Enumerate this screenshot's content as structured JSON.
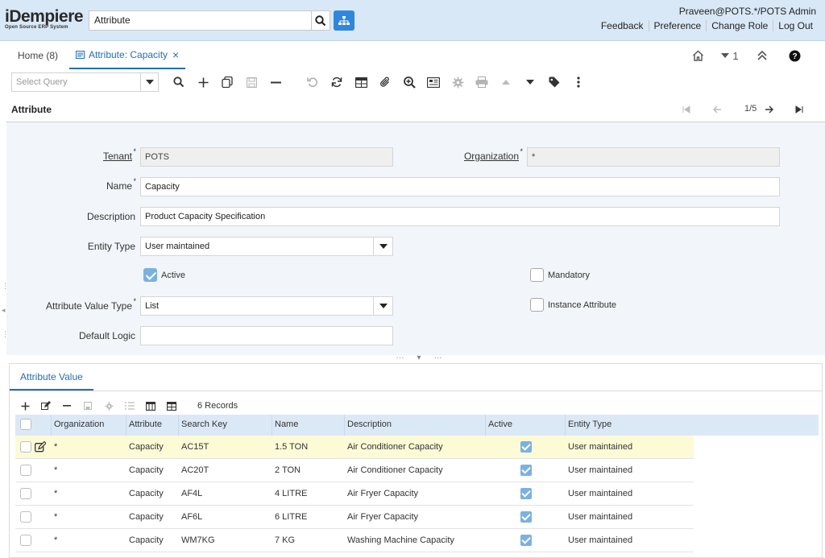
{
  "header": {
    "logo_text": "iDempiere",
    "logo_subtext": "Open Source ERP System",
    "search_value": "Attribute",
    "user": "Praveen@POTS.*/POTS Admin",
    "links": [
      "Feedback",
      "Preference",
      "Change Role",
      "Log Out"
    ]
  },
  "tabs": {
    "home_label": "Home (8)",
    "active_label": "Attribute: Capacity",
    "close_glyph": "×",
    "window_count": "1"
  },
  "toolbar": {
    "query_placeholder": "Select Query"
  },
  "record": {
    "title": "Attribute",
    "position": "1/5"
  },
  "form": {
    "tenant_label": "Tenant",
    "tenant_value": "POTS",
    "org_label": "Organization",
    "org_value": "*",
    "name_label": "Name",
    "name_value": "Capacity",
    "desc_label": "Description",
    "desc_value": "Product Capacity Specification",
    "entity_label": "Entity Type",
    "entity_value": "User maintained",
    "active_label": "Active",
    "active_checked": true,
    "mandatory_label": "Mandatory",
    "mandatory_checked": false,
    "avt_label": "Attribute Value Type",
    "avt_value": "List",
    "instance_label": "Instance Attribute",
    "instance_checked": false,
    "default_label": "Default Logic",
    "default_value": "",
    "required_mark": "*"
  },
  "detail": {
    "tab_label": "Attribute Value",
    "records_label": "6 Records",
    "columns": [
      "Organization",
      "Attribute",
      "Search Key",
      "Name",
      "Description",
      "Active",
      "Entity Type"
    ],
    "rows": [
      {
        "org": "*",
        "attribute": "Capacity",
        "key": "AC15T",
        "name": "1.5 TON",
        "description": "Air Conditioner Capacity",
        "active": true,
        "entity": "User maintained"
      },
      {
        "org": "*",
        "attribute": "Capacity",
        "key": "AC20T",
        "name": "2 TON",
        "description": "Air Conditioner Capacity",
        "active": true,
        "entity": "User maintained"
      },
      {
        "org": "*",
        "attribute": "Capacity",
        "key": "AF4L",
        "name": "4 LITRE",
        "description": "Air Fryer Capacity",
        "active": true,
        "entity": "User maintained"
      },
      {
        "org": "*",
        "attribute": "Capacity",
        "key": "AF6L",
        "name": "6 LITRE",
        "description": "Air Fryer Capacity",
        "active": true,
        "entity": "User maintained"
      },
      {
        "org": "*",
        "attribute": "Capacity",
        "key": "WM7KG",
        "name": "7 KG",
        "description": "Washing Machine Capacity",
        "active": true,
        "entity": "User maintained"
      }
    ]
  },
  "colors": {
    "header_bg": "#d9e8f6",
    "accent": "#1f6fbf",
    "menu_button": "#2e86de",
    "checkbox_on": "#7ab1e3",
    "selected_row": "#fcfbd6",
    "grid_header": "#dbe9f7"
  }
}
